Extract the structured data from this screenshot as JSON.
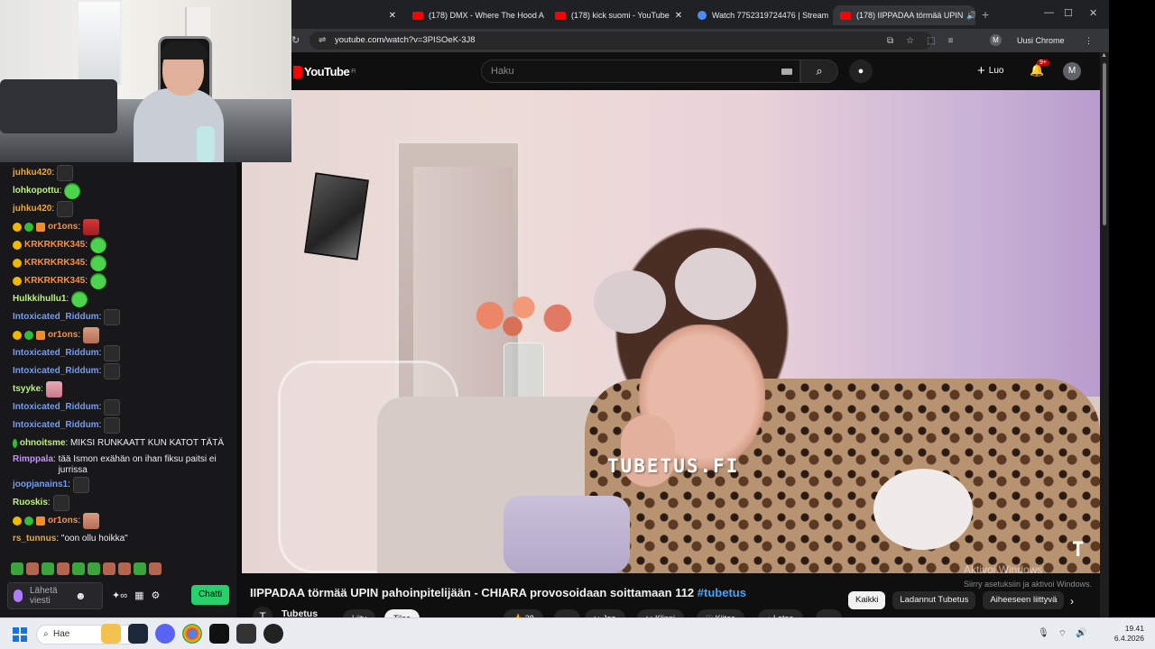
{
  "chat": {
    "messages": [
      {
        "user": "juhku420",
        "user_color": "#f5a623",
        "emote": "dark"
      },
      {
        "user": "lohkopottu",
        "user_color": "#b9f571",
        "emote": "green"
      },
      {
        "user": "juhku420",
        "user_color": "#f5a623",
        "emote": "dark"
      },
      {
        "user": "or1ons",
        "user_color": "#ff8f3a",
        "badges": [
          "gold",
          "green",
          "gift"
        ],
        "emote": "red"
      },
      {
        "user": "KRKRKRK345",
        "user_color": "#ff8f3a",
        "badges": [
          "gold"
        ],
        "emote": "green"
      },
      {
        "user": "KRKRKRK345",
        "user_color": "#ff8f3a",
        "badges": [
          "gold"
        ],
        "emote": "green"
      },
      {
        "user": "KRKRKRK345",
        "user_color": "#ff8f3a",
        "badges": [
          "gold"
        ],
        "emote": "green"
      },
      {
        "user": "Hulkkihullu1",
        "user_color": "#b9f571",
        "emote": "green"
      },
      {
        "user": "Intoxicated_Riddum",
        "user_color": "#6f9cff",
        "emote": "dark"
      },
      {
        "user": "or1ons",
        "user_color": "#ff8f3a",
        "badges": [
          "gold",
          "green",
          "gift"
        ],
        "emote": "face"
      },
      {
        "user": "Intoxicated_Riddum",
        "user_color": "#6f9cff",
        "emote": "dark"
      },
      {
        "user": "Intoxicated_Riddum",
        "user_color": "#6f9cff",
        "emote": "dark"
      },
      {
        "user": "tsyyke",
        "user_color": "#b9f571",
        "emote": "pink"
      },
      {
        "user": "Intoxicated_Riddum",
        "user_color": "#6f9cff",
        "emote": "dark"
      },
      {
        "user": "Intoxicated_Riddum",
        "user_color": "#6f9cff",
        "emote": "dark"
      },
      {
        "user": "ohnoitsme",
        "user_color": "#b9f571",
        "badges": [
          "green"
        ],
        "text": "MIKSI RUNKAATT KUN KATOT TÄTÄ"
      },
      {
        "user": "Rimppala",
        "user_color": "#c792ff",
        "text": "tää Ismon exähän on ihan fiksu paitsi ei jurrissa",
        "tall": true
      },
      {
        "user": "joopjanains1",
        "user_color": "#6f9cff",
        "emote": "dark"
      },
      {
        "user": "Ruoskis",
        "user_color": "#b9f571",
        "emote": "dark"
      },
      {
        "user": "or1ons",
        "user_color": "#ff8f3a",
        "badges": [
          "gold",
          "green",
          "gift"
        ],
        "emote": "face"
      },
      {
        "user": "rs_tunnus",
        "user_color": "#f5a623",
        "text": "\"oon ollu hoikka\""
      }
    ],
    "input_placeholder": "Lähetä viesti",
    "send_label": "Chatti"
  },
  "browser": {
    "tabs": [
      {
        "title": "",
        "icon": "",
        "active": false
      },
      {
        "title": "(178) DMX - Where The Hood A",
        "icon": "youtube",
        "active": false
      },
      {
        "title": "(178) kick suomi - YouTube",
        "icon": "youtube",
        "active": false
      },
      {
        "title": "Watch 7752319724476 | Stream",
        "icon": "stream",
        "active": false
      },
      {
        "title": "(178) IIPPADAA törmää UPIN",
        "icon": "youtube",
        "active": true
      }
    ],
    "url": "youtube.com/watch?v=3PISOeK-3J8",
    "profile_initial": "M",
    "update_label": "Uusi Chrome saatavilla"
  },
  "youtube": {
    "logo": "YouTube",
    "logo_region": "FI",
    "search_placeholder": "Haku",
    "create_label": "Luo",
    "notif_count": "9+",
    "avatar_initial": "M",
    "video_watermark": "TUBETUS.FI",
    "video_title": "IIPPADAA törmää UPIN pahoinpitelijään - CHIARA provosoidaan soittamaan 112",
    "video_hashtag": "#tubetus",
    "channel_name": "Tubetus",
    "join_label": "Liity",
    "subscribe_label": "Tilaa",
    "like_count": "28",
    "share_label": "Jaa",
    "clip_label": "Klippi",
    "thanks_label": "Kiitos",
    "download_label": "Lataa",
    "chips": [
      "Kaikki",
      "Ladannut Tubetus",
      "Aiheeseen liittyvä"
    ]
  },
  "windows": {
    "activate_title": "Aktivoi Windows",
    "activate_sub": "Siirry asetuksiin ja aktivoi Windows.",
    "search_label": "Hae",
    "time": "19.41",
    "date": "6.4.2026"
  },
  "colors": {
    "accent_green": "#27d06a",
    "youtube_red": "#ff0000",
    "link_blue": "#3ea6ff"
  }
}
